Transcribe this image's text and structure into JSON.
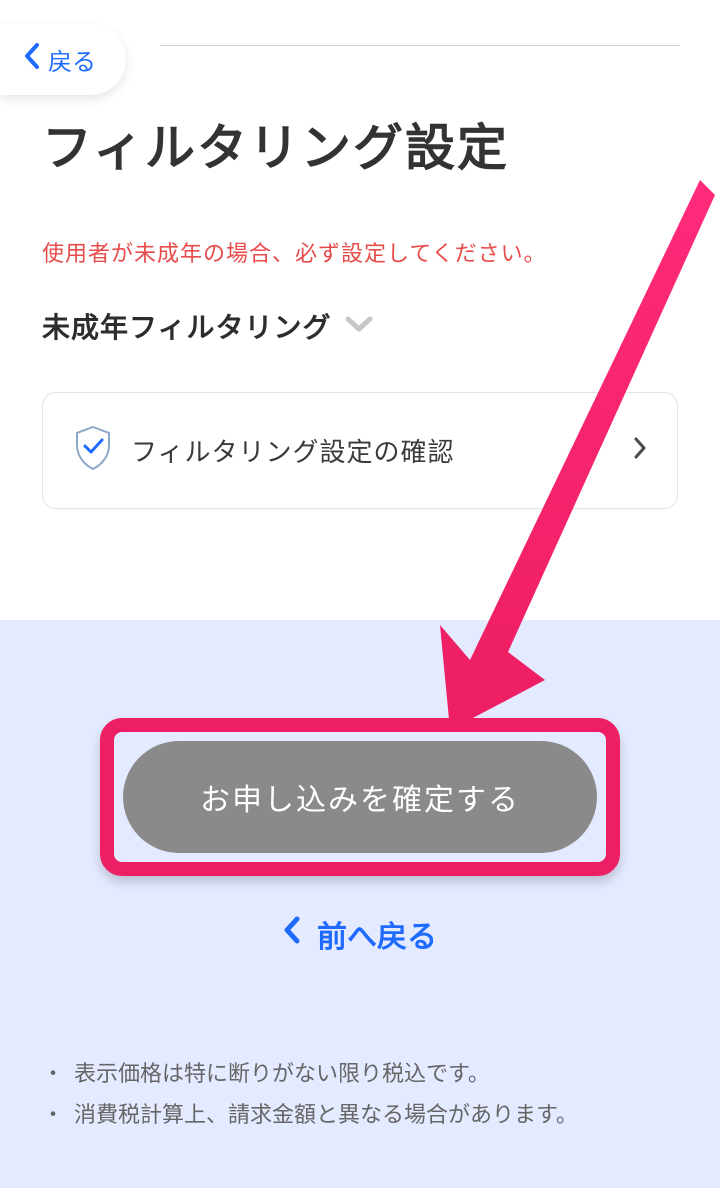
{
  "back": {
    "label": "戻る"
  },
  "title": "フィルタリング設定",
  "warning": "使用者が未成年の場合、必ず設定してください。",
  "filter_label": "未成年フィルタリング",
  "card": {
    "label": "フィルタリング設定の確認"
  },
  "confirm_button": "お申し込みを確定する",
  "prev_link": "前へ戻る",
  "notes": [
    "表示価格は特に断りがない限り税込です。",
    "消費税計算上、請求金額と異なる場合があります。"
  ],
  "colors": {
    "accent_blue": "#1f6bff",
    "warn_red": "#e84b4b",
    "highlight_pink": "#ed1e63",
    "lower_bg": "#e4eaff"
  }
}
